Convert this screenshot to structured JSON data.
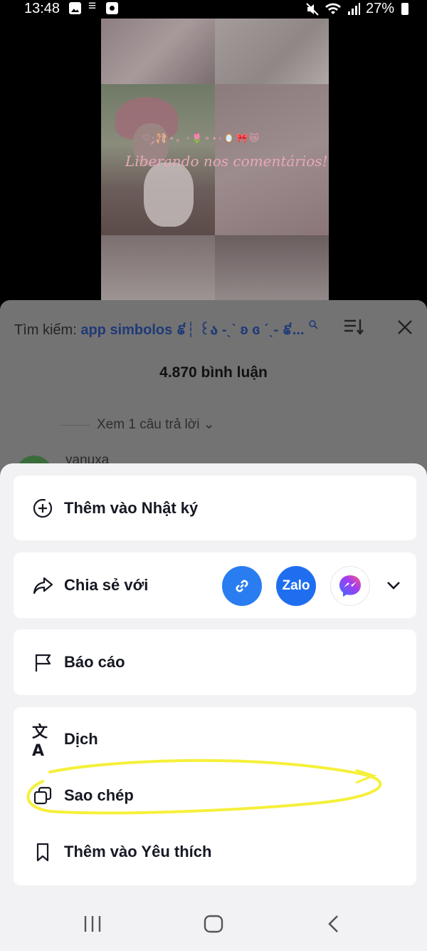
{
  "status_bar": {
    "time": "13:48",
    "battery": "27%",
    "left_icons": [
      "gallery-icon",
      "sliders-icon",
      "record-icon"
    ],
    "right_icons": [
      "mute-icon",
      "wifi-icon",
      "signal-icon",
      "battery-icon"
    ]
  },
  "video": {
    "emoji_line": "♡·༘🩰⋆。◦🌷∘⋆◦🪞🎀😿",
    "overlay_text": "Liberando nos comentários!"
  },
  "comments": {
    "search_label": "Tìm kiếm:",
    "search_query": "app simbolos ៩┆ ꒰ა -ˎˋ ʚ ɞ ˊˎ- ៩...",
    "count": "4.870 bình luận",
    "view_replies": "Xem 1 câu trả lời",
    "next_username": "yanuxa"
  },
  "sheet": {
    "add_to_diary": "Thêm vào Nhật ký",
    "share_with": "Chia sẻ với",
    "zalo": "Zalo",
    "report": "Báo cáo",
    "translate": "Dịch",
    "copy": "Sao chép",
    "add_to_favorites": "Thêm vào Yêu thích"
  },
  "colors": {
    "accent_blue": "#2a7df0",
    "zalo_blue": "#1f6ef0",
    "highlight_yellow": "#f5f03a",
    "sheet_bg": "#f2f2f4",
    "dim_panel": "#737373"
  }
}
